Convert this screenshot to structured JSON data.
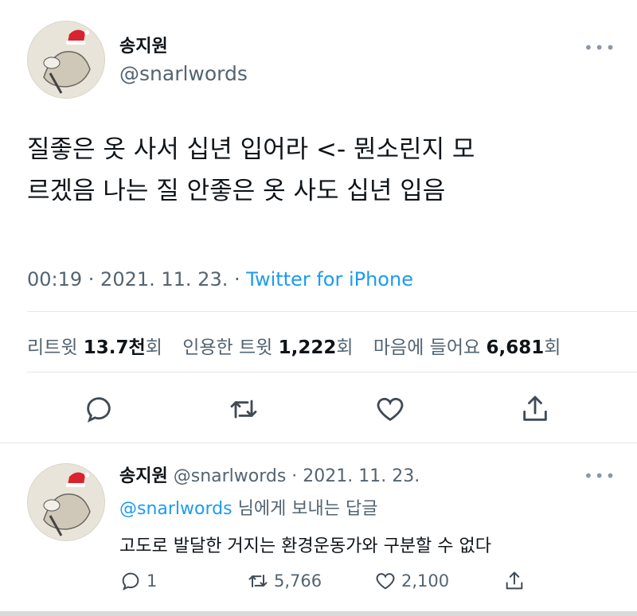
{
  "tweet": {
    "display_name": "송지원",
    "handle": "@snarlwords",
    "more": "•••",
    "text_line1": "질좋은 옷 사서 십년 입어라 <- 뭔소린지 모",
    "text_line2": "르겠음 나는 질 안좋은 옷 사도 십년 입음",
    "time": "00:19 · 2021. 11. 23. · ",
    "source": "Twitter for iPhone",
    "stats": {
      "retweets_label": "리트윗",
      "retweets_value": "13.7천",
      "retweets_unit": "회",
      "quotes_label": "인용한 트윗",
      "quotes_value": "1,222",
      "quotes_unit": "회",
      "likes_label": "마음에 들어요",
      "likes_value": "6,681",
      "likes_unit": "회"
    }
  },
  "reply": {
    "display_name": "송지원",
    "handle_date": "@snarlwords · 2021. 11. 23.",
    "more": "•••",
    "replying_to_handle": "@snarlwords",
    "replying_to_suffix": " 님에게 보내는 답글",
    "text": "고도로 발달한 거지는 환경운동가와 구분할 수 없다",
    "reply_count": "1",
    "retweet_count": "5,766",
    "like_count": "2,100"
  },
  "colors": {
    "accent": "#1d9bf0",
    "secondary": "#536471",
    "icon": "#3f4a55"
  }
}
